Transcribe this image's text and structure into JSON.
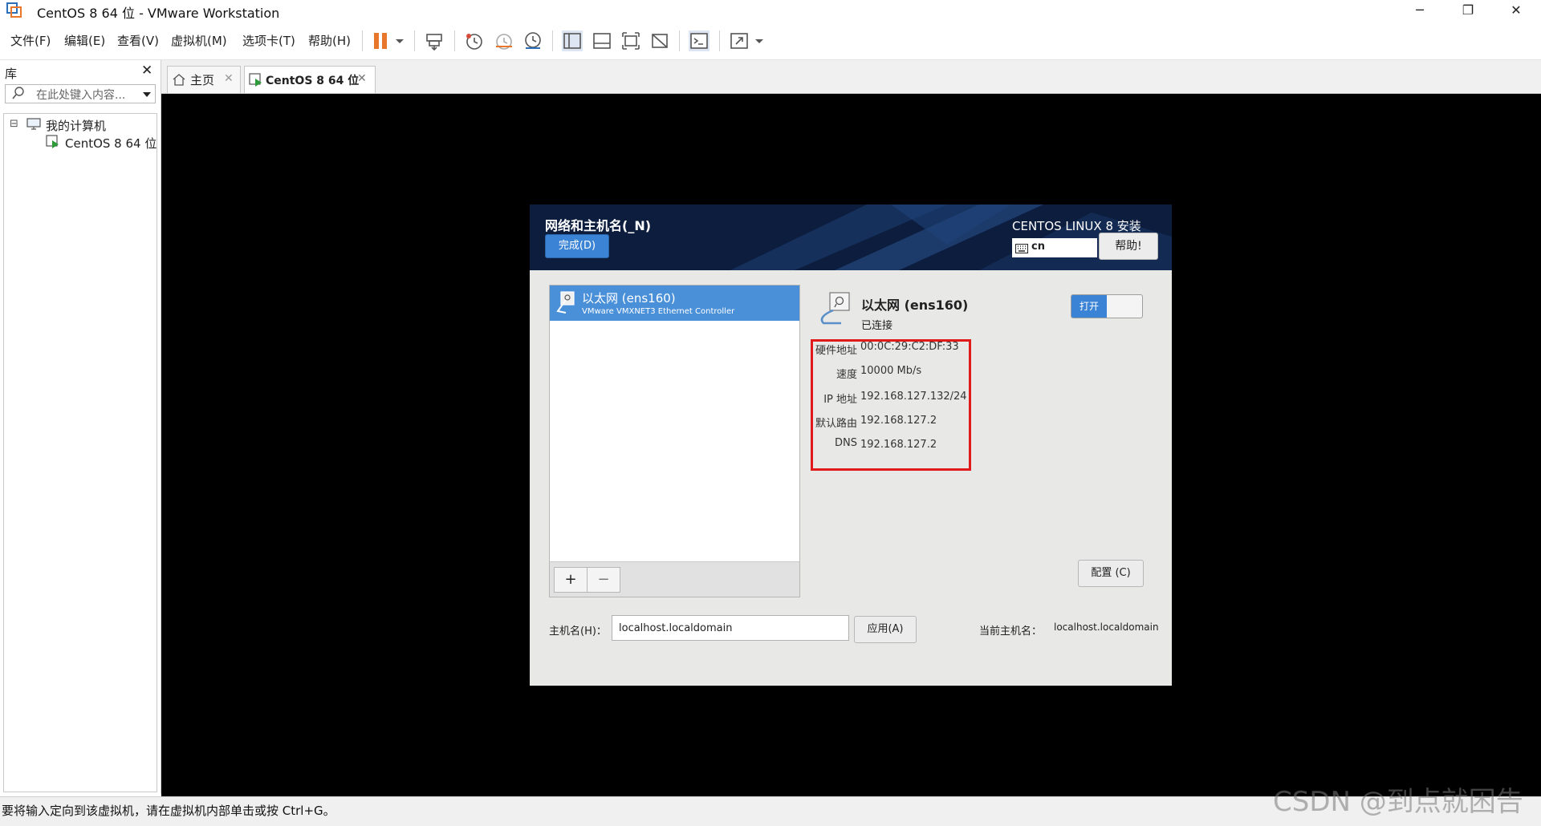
{
  "window": {
    "title": "CentOS 8 64 位 - VMware Workstation",
    "minimize": "─",
    "restore": "❐",
    "close": "✕"
  },
  "menu": [
    "文件(F)",
    "编辑(E)",
    "查看(V)",
    "虚拟机(M)",
    "选项卡(T)",
    "帮助(H)"
  ],
  "library": {
    "title": "库",
    "close": "✕",
    "search_placeholder": "在此处键入内容...",
    "tree": {
      "expander": "⊟",
      "root": "我的计算机",
      "children": [
        "CentOS 8 64 位"
      ]
    }
  },
  "tabs": [
    {
      "label": "主页",
      "close": "✕"
    },
    {
      "label": "CentOS 8 64 位",
      "close": "✕"
    }
  ],
  "installer": {
    "title": "网络和主机名(_N)",
    "done_button": "完成(D)",
    "product": "CENTOS LINUX 8 安装",
    "keyboard": "cn",
    "help_button": "帮助!",
    "interface_list": [
      {
        "name": "以太网 (ens160)",
        "description": "VMware VMXNET3 Ethernet Controller"
      }
    ],
    "add_button": "+",
    "remove_button": "−",
    "device": {
      "name": "以太网 (ens160)",
      "status": "已连接",
      "toggle_label": "打开",
      "details": [
        {
          "label": "硬件地址",
          "value": "00:0C:29:C2:DF:33"
        },
        {
          "label": "速度",
          "value": "10000 Mb/s"
        },
        {
          "label": "IP 地址",
          "value": "192.168.127.132/24"
        },
        {
          "label": "默认路由",
          "value": "192.168.127.2"
        },
        {
          "label": "DNS",
          "value": "192.168.127.2"
        }
      ]
    },
    "config_button": "配置 (C)",
    "hostname_label": "主机名(H)：",
    "hostname_value": "localhost.localdomain",
    "apply_button": "应用(A)",
    "current_hostname_label": "当前主机名：",
    "current_hostname_value": "localhost.localdomain"
  },
  "statusbar": {
    "message": "要将输入定向到该虚拟机，请在虚拟机内部单击或按 Ctrl+G。"
  },
  "watermark": "CSDN @到点就困告",
  "colors": {
    "installer_header": "#0c1d3e",
    "accent_blue": "#3b83d4",
    "highlight_red": "#e0191b",
    "pause_orange": "#e8762b"
  }
}
